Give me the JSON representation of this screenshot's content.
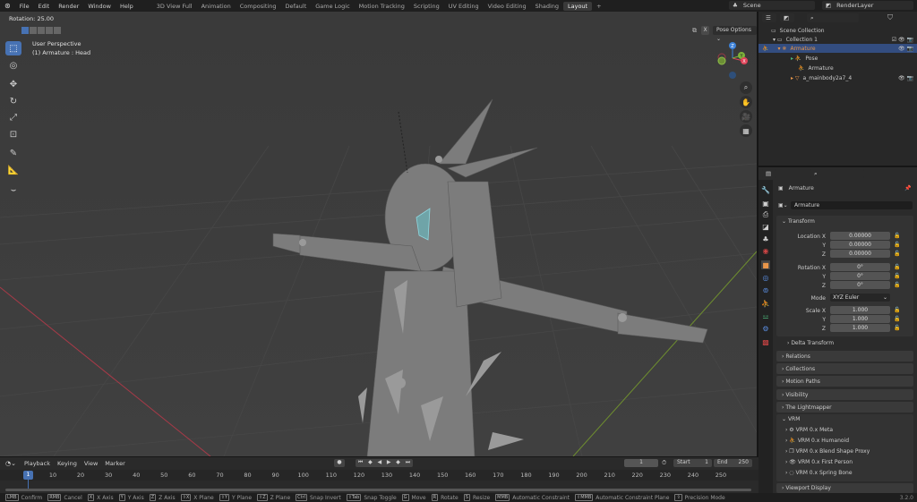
{
  "topbar": {
    "menus": [
      "File",
      "Edit",
      "Render",
      "Window",
      "Help"
    ],
    "workspaces": [
      "3D View Full",
      "Animation",
      "Compositing",
      "Default",
      "Game Logic",
      "Motion Tracking",
      "Scripting",
      "UV Editing",
      "Video Editing",
      "Shading",
      "Layout"
    ],
    "active_workspace": "Layout",
    "add_tab": "+",
    "scene": "Scene",
    "view_layer": "RenderLayer"
  },
  "viewport": {
    "operator_info": "Rotation: 25.00",
    "view_name": "User Perspective",
    "active_object": "(1) Armature : Head",
    "pose_options": "Pose Options",
    "mirror_x": "X",
    "gizmo": {
      "z": "Z",
      "y": "Y",
      "x": "X"
    }
  },
  "outliner": {
    "items": [
      {
        "label": "Scene Collection"
      },
      {
        "label": "Collection 1"
      },
      {
        "label": "Armature",
        "selected": true
      },
      {
        "label": "Pose"
      },
      {
        "label": "Armature"
      },
      {
        "label": "a_mainbody2a7_4"
      }
    ]
  },
  "properties": {
    "object_name": "Armature",
    "data_name": "Armature",
    "transform_title": "Transform",
    "location": {
      "label": "Location X",
      "x": "0.00000",
      "y": "0.00000",
      "z": "0.00000"
    },
    "rotation": {
      "label": "Rotation X",
      "x": "0°",
      "y": "0°",
      "z": "0°"
    },
    "mode": {
      "label": "Mode",
      "value": "XYZ Euler"
    },
    "scale": {
      "label": "Scale X",
      "x": "1.000",
      "y": "1.000",
      "z": "1.000"
    },
    "axis_y": "Y",
    "axis_z": "Z",
    "panels": [
      "Delta Transform",
      "Relations",
      "Collections",
      "Motion Paths",
      "Visibility",
      "The Lightmapper",
      "VRM"
    ],
    "vrm_sub": [
      "VRM 0.x Meta",
      "VRM 0.x Humanoid",
      "VRM 0.x Blend Shape Proxy",
      "VRM 0.x First Person",
      "VRM 0.x Spring Bone"
    ],
    "next_panel": "Viewport Display"
  },
  "timeline": {
    "menus": [
      "Playback",
      "Keying",
      "View",
      "Marker"
    ],
    "current_frame": "1",
    "start_label": "Start",
    "start": "1",
    "end_label": "End",
    "end": "250",
    "ticks": [
      "10",
      "20",
      "30",
      "40",
      "50",
      "60",
      "70",
      "80",
      "90",
      "100",
      "110",
      "120",
      "130",
      "140",
      "150",
      "160",
      "170",
      "180",
      "190",
      "200",
      "210",
      "220",
      "230",
      "240",
      "250"
    ]
  },
  "status": {
    "hints": [
      {
        "key": "LMB",
        "label": "Confirm"
      },
      {
        "key": "RMB",
        "label": "Cancel"
      },
      {
        "key": "X",
        "label": "X Axis"
      },
      {
        "key": "Y",
        "label": "Y Axis"
      },
      {
        "key": "Z",
        "label": "Z Axis"
      },
      {
        "key": "⇧X",
        "label": "X Plane"
      },
      {
        "key": "⇧Y",
        "label": "Y Plane"
      },
      {
        "key": "⇧Z",
        "label": "Z Plane"
      },
      {
        "key": "Ctrl",
        "label": "Snap Invert"
      },
      {
        "key": "⇧Tab",
        "label": "Snap Toggle"
      },
      {
        "key": "G",
        "label": "Move"
      },
      {
        "key": "R",
        "label": "Rotate"
      },
      {
        "key": "S",
        "label": "Resize"
      },
      {
        "key": "MMB",
        "label": "Automatic Constraint"
      },
      {
        "key": "⇧MMB",
        "label": "Automatic Constraint Plane"
      },
      {
        "key": "⇧",
        "label": "Precision Mode"
      }
    ],
    "version": "3.2.0"
  },
  "colors": {
    "accent": "#4772b3",
    "x_axis": "#e0445a",
    "y_axis": "#7db33a",
    "z_axis": "#3d82d9"
  }
}
